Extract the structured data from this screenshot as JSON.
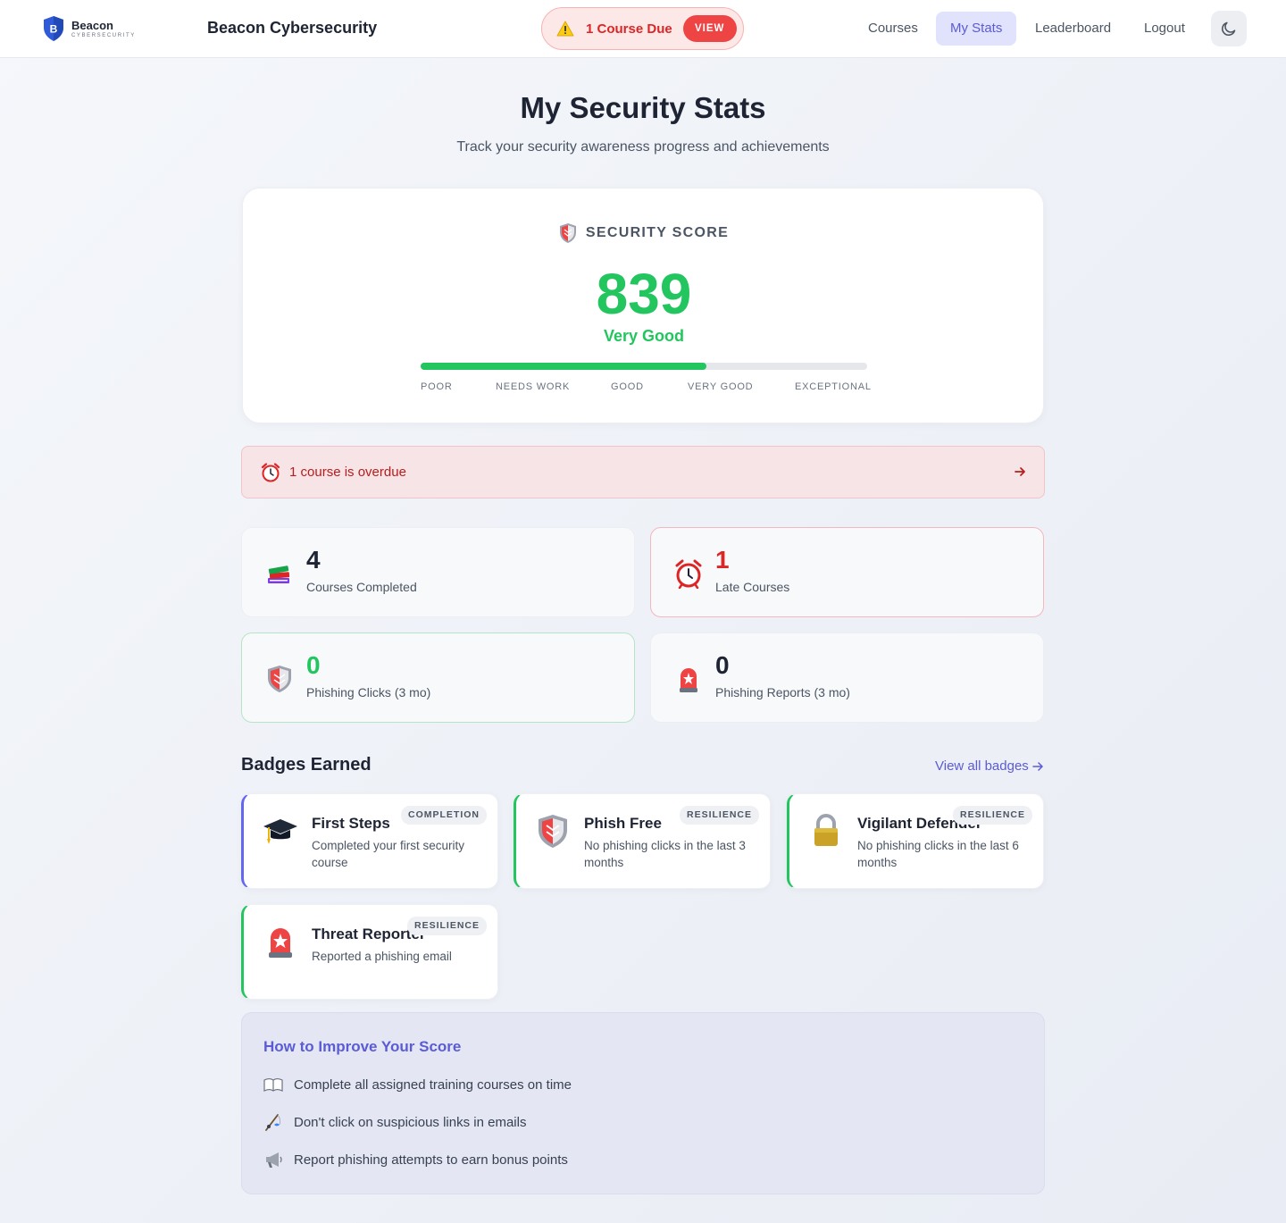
{
  "header": {
    "logo_name": "Beacon",
    "logo_sub": "CYBERSECURITY",
    "app_title": "Beacon Cybersecurity",
    "due_text": "1 Course Due",
    "view_label": "VIEW",
    "nav": [
      {
        "label": "Courses",
        "active": false
      },
      {
        "label": "My Stats",
        "active": true
      },
      {
        "label": "Leaderboard",
        "active": false
      },
      {
        "label": "Logout",
        "active": false
      }
    ],
    "theme_icon": "moon-icon"
  },
  "page": {
    "title": "My Security Stats",
    "subtitle": "Track your security awareness progress and achievements"
  },
  "score": {
    "label": "SECURITY SCORE",
    "value": "839",
    "rating": "Very Good",
    "progress_fraction": 0.64,
    "scale": [
      "POOR",
      "NEEDS WORK",
      "GOOD",
      "VERY GOOD",
      "EXCEPTIONAL"
    ],
    "color": "#22c55e"
  },
  "overdue_banner": {
    "text": "1 course is overdue",
    "icon": "alarm-clock-icon"
  },
  "stats": [
    {
      "value": "4",
      "label": "Courses Completed",
      "icon": "books-icon"
    },
    {
      "value": "1",
      "label": "Late Courses",
      "icon": "alarm-clock-icon"
    },
    {
      "value": "0",
      "label": "Phishing Clicks (3 mo)",
      "icon": "shield-icon"
    },
    {
      "value": "0",
      "label": "Phishing Reports (3 mo)",
      "icon": "siren-icon"
    }
  ],
  "badges": {
    "title": "Badges Earned",
    "view_all": "View all badges",
    "items": [
      {
        "title": "First Steps",
        "tag": "COMPLETION",
        "desc": "Completed your first security course",
        "icon": "graduation-cap-icon"
      },
      {
        "title": "Phish Free",
        "tag": "RESILIENCE",
        "desc": "No phishing clicks in the last 3 months",
        "icon": "shield-icon"
      },
      {
        "title": "Vigilant Defender",
        "tag": "RESILIENCE",
        "desc": "No phishing clicks in the last 6 months",
        "icon": "lock-icon"
      },
      {
        "title": "Threat Reporter",
        "tag": "RESILIENCE",
        "desc": "Reported a phishing email",
        "icon": "siren-icon"
      }
    ]
  },
  "tips": {
    "title": "How to Improve Your Score",
    "items": [
      {
        "text": "Complete all assigned training courses on time",
        "icon": "open-book-icon"
      },
      {
        "text": "Don't click on suspicious links in emails",
        "icon": "fishing-pole-icon"
      },
      {
        "text": "Report phishing attempts to earn bonus points",
        "icon": "megaphone-icon"
      }
    ]
  },
  "colors": {
    "accent": "#5b5bd6",
    "success": "#22c55e",
    "danger": "#dc2626"
  }
}
